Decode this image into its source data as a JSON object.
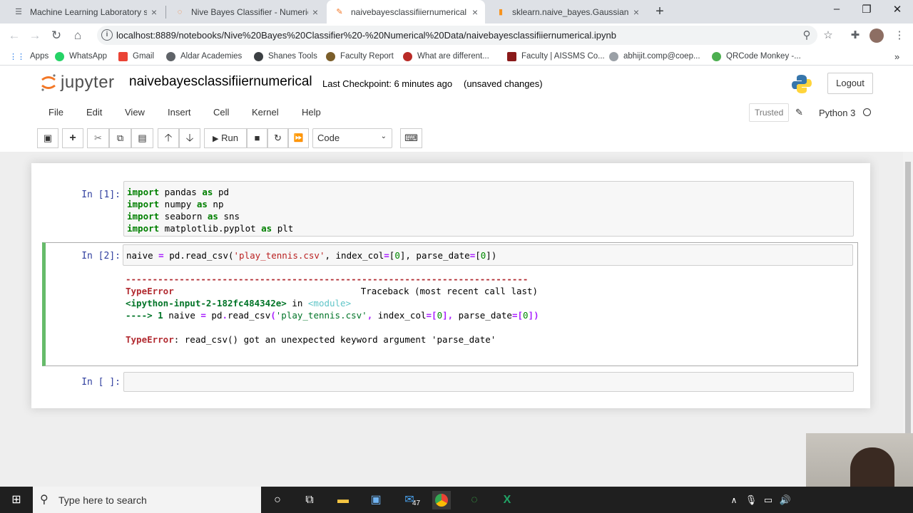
{
  "browser": {
    "tabs": [
      {
        "title": "Machine Learning Laboratory sy",
        "icon": "document-icon"
      },
      {
        "title": "Nive Bayes Classifier - Numerica",
        "icon": "jupyter-icon"
      },
      {
        "title": "naivebayesclassifiiernumerical -",
        "icon": "notebook-icon"
      },
      {
        "title": "sklearn.naive_bayes.GaussianNB",
        "icon": "sklearn-icon"
      }
    ],
    "url": "localhost:8889/notebooks/Nive%20Bayes%20Classifier%20-%20Numerical%20Data/naivebayesclassifiiernumerical.ipynb",
    "bookmarks": [
      "Apps",
      "WhatsApp",
      "Gmail",
      "Aldar Academies",
      "Shanes Tools",
      "Faculty Report",
      "What are different...",
      "Faculty | AISSMS Co...",
      "abhijit.comp@coep...",
      "QRCode Monkey -..."
    ]
  },
  "jupyter": {
    "logo_text": "jupyter",
    "notebook_name": "naivebayesclassifiiernumerical",
    "checkpoint": "Last Checkpoint: 6 minutes ago",
    "status": "(unsaved changes)",
    "logout": "Logout",
    "menu": [
      "File",
      "Edit",
      "View",
      "Insert",
      "Cell",
      "Kernel",
      "Help"
    ],
    "trusted": "Trusted",
    "kernel": "Python 3",
    "run_label": "Run",
    "cell_type": "Code"
  },
  "cells": {
    "c1_prompt": "In [1]:",
    "c2_prompt": "In [2]:",
    "c3_prompt": "In [ ]:",
    "err_dashes": "---------------------------------------------------------------------------",
    "err_type": "TypeError",
    "err_traceback": "Traceback (most recent call last)",
    "err_input": "<ipython-input-2-182fc484342e>",
    "err_in": " in ",
    "err_module": "<module>",
    "err_msg": ": read_csv() got an unexpected keyword argument 'parse_date'"
  },
  "taskbar": {
    "search_placeholder": "Type here to search",
    "mail_badge": "47"
  },
  "colors": {
    "selected_cell_border": "#66bb6a",
    "prompt_color": "#303f9f",
    "keyword": "#008000"
  }
}
